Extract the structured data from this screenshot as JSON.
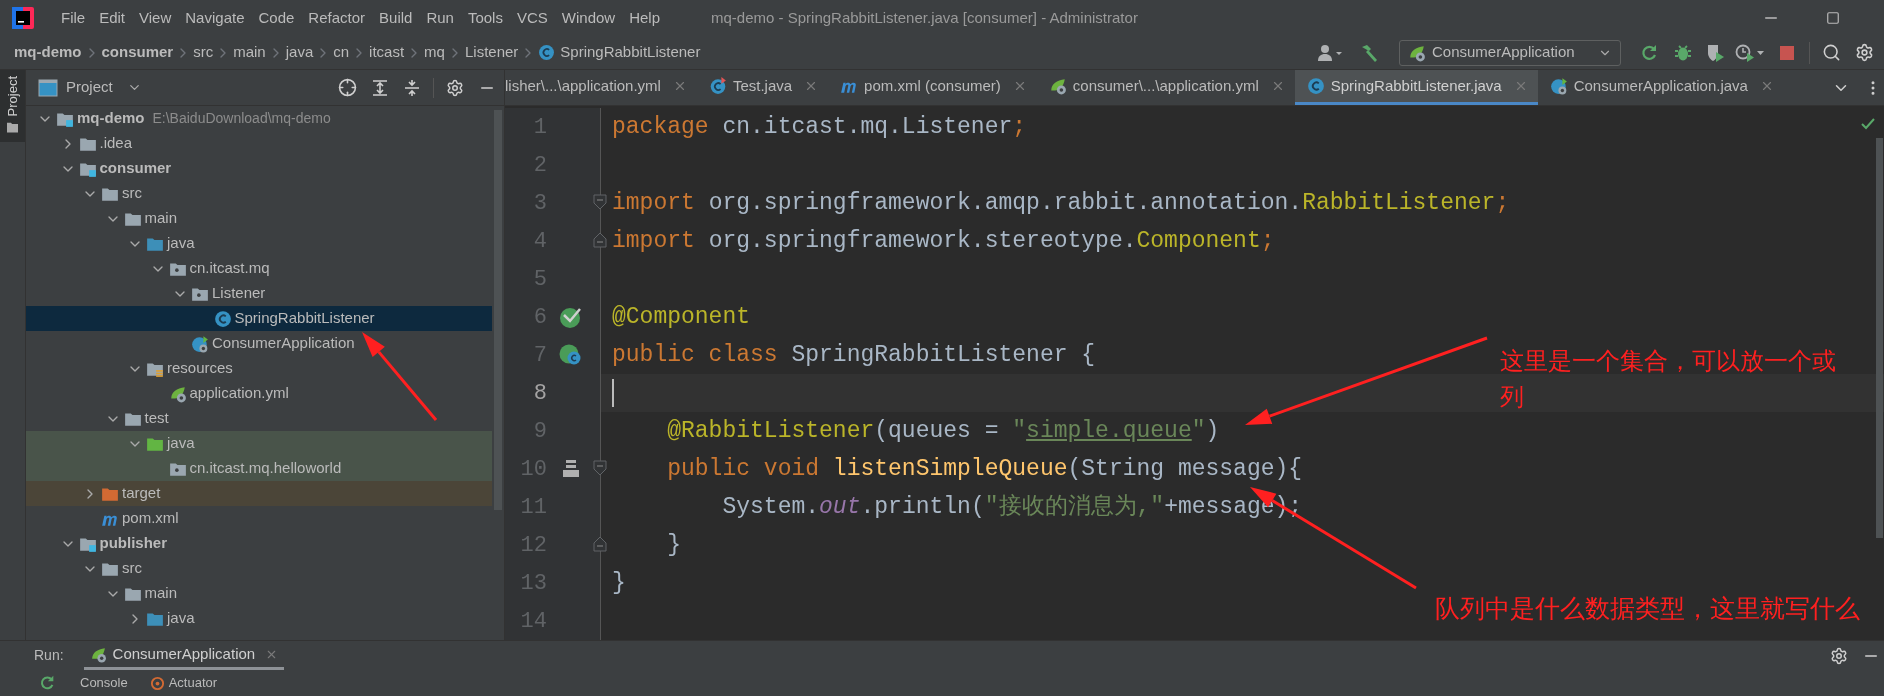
{
  "window": {
    "title": "mq-demo - SpringRabbitListener.java [consumer] - Administrator"
  },
  "menu": [
    {
      "label": "File"
    },
    {
      "label": "Edit"
    },
    {
      "label": "View"
    },
    {
      "label": "Navigate"
    },
    {
      "label": "Code"
    },
    {
      "label": "Refactor"
    },
    {
      "label": "Build"
    },
    {
      "label": "Run"
    },
    {
      "label": "Tools"
    },
    {
      "label": "VCS"
    },
    {
      "label": "Window"
    },
    {
      "label": "Help"
    }
  ],
  "breadcrumb": [
    {
      "label": "mq-demo",
      "bold": true
    },
    {
      "label": "consumer",
      "bold": true
    },
    {
      "label": "src",
      "bold": false
    },
    {
      "label": "main",
      "bold": false
    },
    {
      "label": "java",
      "bold": false
    },
    {
      "label": "cn",
      "bold": false
    },
    {
      "label": "itcast",
      "bold": false
    },
    {
      "label": "mq",
      "bold": false
    },
    {
      "label": "Listener",
      "bold": false
    },
    {
      "label": "SpringRabbitListener",
      "bold": false,
      "kind": "class"
    }
  ],
  "run_config": "ConsumerApplication",
  "project_panel": {
    "side_tab": "Project",
    "title": "Project",
    "tree": [
      {
        "label": "mq-demo",
        "hint": "E:\\BaiduDownload\\mq-demo",
        "kind": "module",
        "bold": true,
        "expanded": true,
        "selected": false,
        "children": [
          {
            "label": ".idea",
            "kind": "folder",
            "bold": false,
            "expanded": false,
            "selected": false
          },
          {
            "label": "consumer",
            "kind": "module",
            "bold": true,
            "expanded": true,
            "selected": false,
            "children": [
              {
                "label": "src",
                "kind": "folder",
                "bold": false,
                "expanded": true,
                "selected": false,
                "children": [
                  {
                    "label": "main",
                    "kind": "folder",
                    "bold": false,
                    "expanded": true,
                    "selected": false,
                    "children": [
                      {
                        "label": "java",
                        "kind": "source_root",
                        "bold": false,
                        "expanded": true,
                        "selected": false,
                        "children": [
                          {
                            "label": "cn.itcast.mq",
                            "kind": "package",
                            "bold": false,
                            "expanded": true,
                            "selected": false,
                            "children": [
                              {
                                "label": "Listener",
                                "kind": "package",
                                "bold": false,
                                "expanded": true,
                                "selected": false,
                                "children": [
                                  {
                                    "label": "SpringRabbitListener",
                                    "kind": "class",
                                    "bold": false,
                                    "selected": true
                                  }
                                ]
                              },
                              {
                                "label": "ConsumerApplication",
                                "kind": "boot_class",
                                "bold": false,
                                "selected": false
                              }
                            ]
                          }
                        ]
                      },
                      {
                        "label": "resources",
                        "kind": "resources_root",
                        "bold": false,
                        "expanded": true,
                        "selected": false,
                        "children": [
                          {
                            "label": "application.yml",
                            "kind": "spring_yml",
                            "bold": false,
                            "selected": false
                          }
                        ]
                      }
                    ]
                  },
                  {
                    "label": "test",
                    "kind": "folder",
                    "bold": false,
                    "expanded": true,
                    "selected": false,
                    "children": [
                      {
                        "label": "java",
                        "kind": "test_root",
                        "bold": false,
                        "expanded": true,
                        "selected": false,
                        "children": [
                          {
                            "label": "cn.itcast.mq.helloworld",
                            "kind": "test_package",
                            "bold": false,
                            "selected": false
                          }
                        ]
                      }
                    ]
                  }
                ]
              },
              {
                "label": "target",
                "kind": "excluded_root",
                "bold": false,
                "expanded": false,
                "selected": false
              },
              {
                "label": "pom.xml",
                "kind": "maven",
                "bold": false,
                "selected": false
              }
            ]
          },
          {
            "label": "publisher",
            "kind": "module",
            "bold": true,
            "expanded": true,
            "selected": false,
            "children": [
              {
                "label": "src",
                "kind": "folder",
                "bold": false,
                "expanded": true,
                "selected": false,
                "children": [
                  {
                    "label": "main",
                    "kind": "folder",
                    "bold": false,
                    "expanded": true,
                    "selected": false,
                    "children": [
                      {
                        "label": "java",
                        "kind": "source_root",
                        "bold": false,
                        "expanded": false,
                        "selected": false
                      }
                    ]
                  }
                ]
              }
            ]
          }
        ]
      }
    ]
  },
  "editor_tabs": [
    {
      "label": "lisher\\...\\application.yml",
      "selected": false
    },
    {
      "label": "Test.java",
      "kind": "test_class",
      "selected": false
    },
    {
      "label": "pom.xml (consumer)",
      "kind": "maven",
      "selected": false
    },
    {
      "label": "consumer\\...\\application.yml",
      "kind": "spring_yml",
      "selected": false
    },
    {
      "label": "SpringRabbitListener.java",
      "kind": "class",
      "selected": true
    },
    {
      "label": "ConsumerApplication.java",
      "kind": "boot_class",
      "selected": false
    }
  ],
  "editor": {
    "lines": [
      {
        "number": "1",
        "current": false,
        "tokens": [
          {
            "text": "package",
            "kind": "kw"
          },
          {
            "text": " cn.itcast.mq.Listener",
            "kind": "plain"
          },
          {
            "text": ";",
            "kind": "kw"
          }
        ]
      },
      {
        "number": "2",
        "current": false
      },
      {
        "number": "3",
        "current": false,
        "fold": {
          "kind": "open"
        },
        "tokens": [
          {
            "text": "import",
            "kind": "kw"
          },
          {
            "text": " org.springframework.amqp.rabbit.annotation.",
            "kind": "plain"
          },
          {
            "text": "RabbitListener",
            "kind": "ann"
          },
          {
            "text": ";",
            "kind": "kw"
          }
        ]
      },
      {
        "number": "4",
        "current": false,
        "fold": {
          "kind": "close"
        },
        "tokens": [
          {
            "text": "import",
            "kind": "kw"
          },
          {
            "text": " org.springframework.stereotype.",
            "kind": "plain"
          },
          {
            "text": "Component",
            "kind": "ann"
          },
          {
            "text": ";",
            "kind": "kw"
          }
        ]
      },
      {
        "number": "5",
        "current": false
      },
      {
        "number": "6",
        "current": false,
        "gutter": {
          "kind": "bean"
        },
        "tokens": [
          {
            "text": "@Component",
            "kind": "ann"
          }
        ]
      },
      {
        "number": "7",
        "current": false,
        "gutter": {
          "kind": "bean_class"
        },
        "tokens": [
          {
            "text": "public class ",
            "kind": "kw"
          },
          {
            "text": "SpringRabbitListener {",
            "kind": "plain"
          }
        ]
      },
      {
        "number": "8",
        "current": true
      },
      {
        "number": "9",
        "current": false,
        "tokens": [
          {
            "text": "    @RabbitListener",
            "kind": "ann"
          },
          {
            "text": "(queues = ",
            "kind": "plain"
          },
          {
            "text": "\"",
            "kind": "str"
          },
          {
            "text": "simple.queue",
            "kind": "link"
          },
          {
            "text": "\"",
            "kind": "str"
          },
          {
            "text": ")",
            "kind": "plain"
          }
        ]
      },
      {
        "number": "10",
        "current": false,
        "gutter": {
          "kind": "listener"
        },
        "fold": {
          "kind": "open"
        },
        "tokens": [
          {
            "text": "    public void ",
            "kind": "kw"
          },
          {
            "text": "listenSimpleQueue",
            "kind": "fn"
          },
          {
            "text": "(String message){",
            "kind": "plain"
          }
        ]
      },
      {
        "number": "11",
        "current": false,
        "tokens": [
          {
            "text": "        System.",
            "kind": "plain"
          },
          {
            "text": "out",
            "kind": "field"
          },
          {
            "text": ".println(",
            "kind": "plain"
          },
          {
            "text": "\"接收的消息为,\"",
            "kind": "str"
          },
          {
            "text": "+message);",
            "kind": "plain"
          }
        ]
      },
      {
        "number": "12",
        "current": false,
        "fold": {
          "kind": "close"
        },
        "tokens": [
          {
            "text": "    }",
            "kind": "plain"
          }
        ]
      },
      {
        "number": "13",
        "current": false,
        "tokens": [
          {
            "text": "}",
            "kind": "plain"
          }
        ]
      },
      {
        "number": "14",
        "current": false
      }
    ]
  },
  "annotations": [
    {
      "text": "这里是一个集合，可以放一个或"
    },
    {
      "text": "列"
    },
    {
      "text": "队列中是什么数据类型，这里就写什么"
    }
  ],
  "run_panel": {
    "label": "Run:",
    "tabs": [
      {
        "label": "ConsumerApplication",
        "selected": true
      }
    ],
    "subtabs": [
      {
        "label": "Console"
      },
      {
        "label": "Actuator",
        "kind": "actuator"
      }
    ]
  }
}
